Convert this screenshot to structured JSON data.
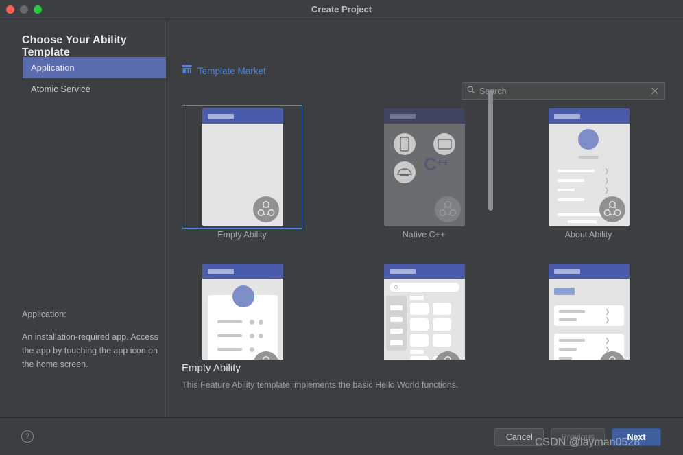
{
  "window": {
    "title": "Create Project",
    "traffic_lights": [
      "close",
      "minimize",
      "zoom"
    ]
  },
  "left_panel": {
    "heading": "Choose Your Ability Template",
    "types": [
      {
        "label": "Application",
        "selected": true
      },
      {
        "label": "Atomic Service",
        "selected": false
      }
    ],
    "description_title": "Application:",
    "description_body": "An installation-required app. Access the app by touching the app icon on the home screen."
  },
  "right_panel": {
    "market_link": "Template Market",
    "market_icon": "shop-icon",
    "search": {
      "placeholder": "Search",
      "value": "",
      "icon": "search-icon",
      "clear_icon": "clear-icon"
    },
    "templates": [
      {
        "name": "Empty Ability",
        "selected": true,
        "enabled": true,
        "kind": "empty"
      },
      {
        "name": "Native C++",
        "selected": false,
        "enabled": false,
        "kind": "native"
      },
      {
        "name": "About Ability",
        "selected": false,
        "enabled": true,
        "kind": "about"
      },
      {
        "name": "",
        "selected": false,
        "enabled": true,
        "kind": "profile"
      },
      {
        "name": "",
        "selected": false,
        "enabled": true,
        "kind": "catalog"
      },
      {
        "name": "",
        "selected": false,
        "enabled": true,
        "kind": "settings"
      }
    ],
    "scrollbar": {
      "orientation": "vertical",
      "thumb_top_pct": 8,
      "thumb_height_pct": 44
    }
  },
  "selection": {
    "name": "Empty Ability",
    "description": "This Feature Ability template implements the basic Hello World functions."
  },
  "footer": {
    "help_label": "?",
    "cancel_label": "Cancel",
    "previous_label": "Previous",
    "next_label": "Next",
    "previous_disabled": true
  },
  "watermark": "CSDN @layman0528",
  "colors": {
    "window_bg": "#3c3f41",
    "accent_blue": "#4d84e8",
    "selection_blue": "#5a6bb0",
    "primary_button": "#3f5f9e",
    "mock_header_blue": "#4a5bab"
  }
}
